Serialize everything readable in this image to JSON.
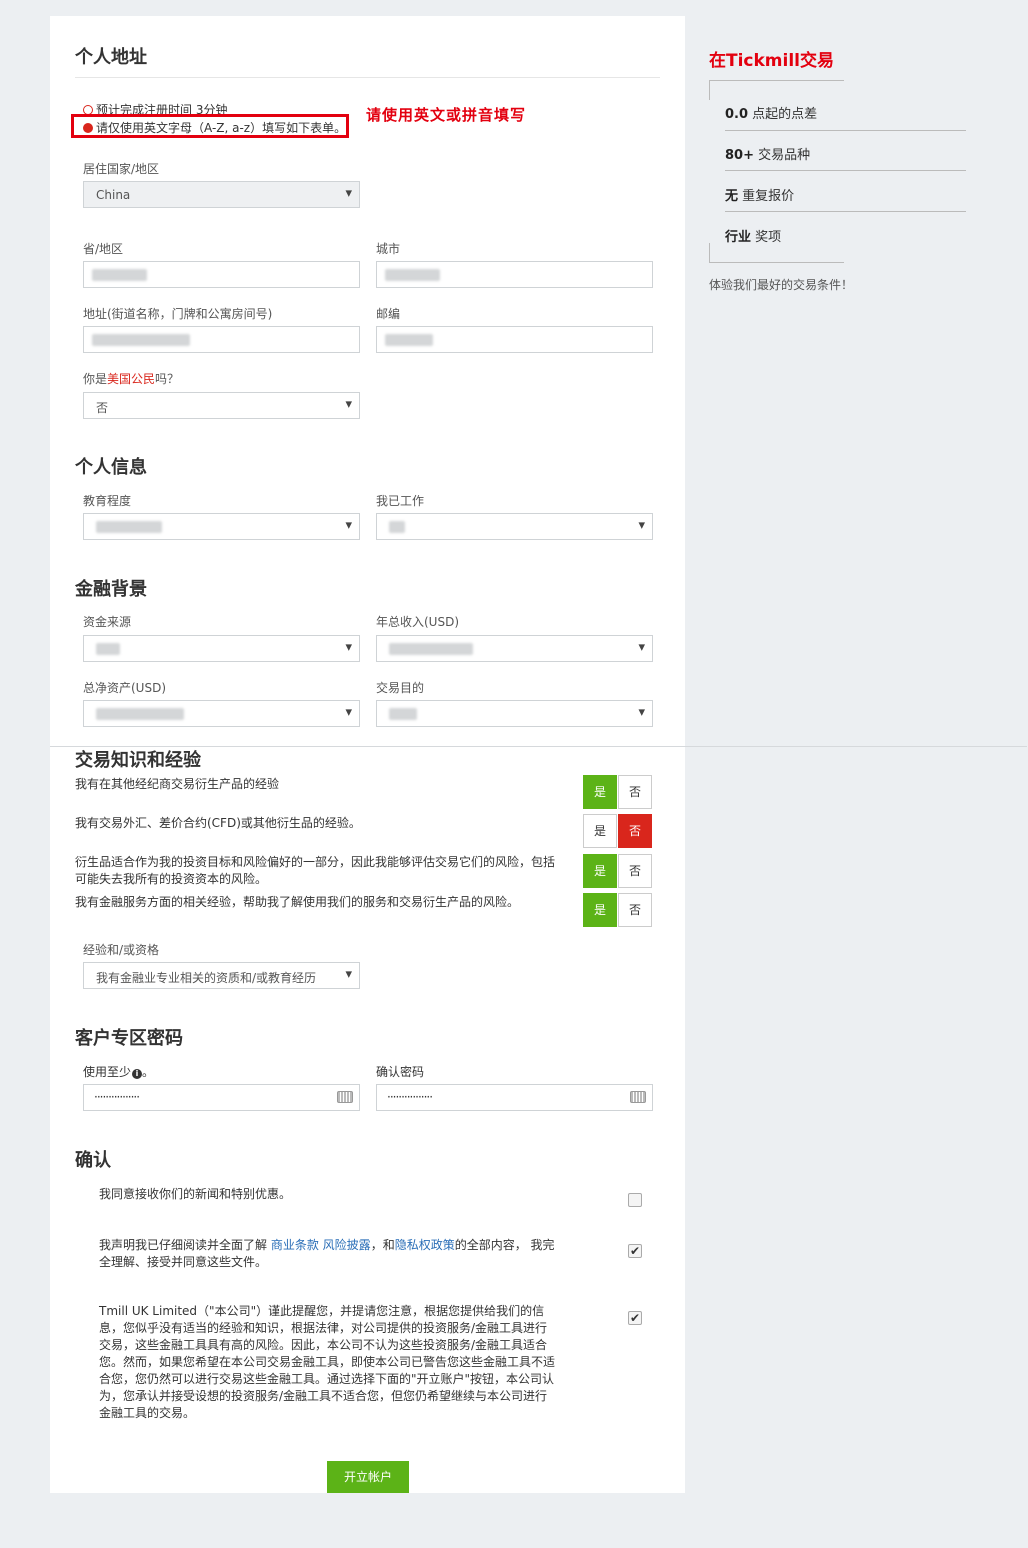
{
  "address_section": {
    "title": "个人地址",
    "hint_time": "预计完成注册时间 3分钟",
    "hint_english": "请仅使用英文字母（A-Z, a-z）填写如下表单。",
    "annotation": "请使用英文或拼音填写",
    "country_label": "居住国家/地区",
    "country_value": "China",
    "province_label": "省/地区",
    "city_label": "城市",
    "address_label": "地址(街道名称，门牌和公寓房间号)",
    "zip_label": "邮编",
    "us_citizen_prefix": "你是",
    "us_citizen_highlight": "美国公民",
    "us_citizen_suffix": "吗？",
    "us_citizen_value": "否"
  },
  "personal_section": {
    "title": "个人信息",
    "education_label": "教育程度",
    "employment_label": "我已工作"
  },
  "financial_section": {
    "title": "金融背景",
    "source_label": "资金来源",
    "income_label": "年总收入(USD)",
    "networth_label": "总净资产(USD)",
    "purpose_label": "交易目的"
  },
  "knowledge_section": {
    "title": "交易知识和经验",
    "yes_label": "是",
    "no_label": "否",
    "questions": [
      {
        "text": "我有在其他经纪商交易衍生产品的经验",
        "answer": "yes"
      },
      {
        "text": "我有交易外汇、差价合约(CFD)或其他衍生品的经验。",
        "answer": "no"
      },
      {
        "text": "衍生品适合作为我的投资目标和风险偏好的一部分，因此我能够评估交易它们的风险，包括可能失去我所有的投资资本的风险。",
        "answer": "yes"
      },
      {
        "text": "我有金融服务方面的相关经验，帮助我了解使用我们的服务和交易衍生产品的风险。",
        "answer": "yes"
      }
    ],
    "qualification_label": "经验和/或资格",
    "qualification_value": "我有金融业专业相关的资质和/或教育经历"
  },
  "password_section": {
    "title": "客户专区密码",
    "password_label": "使用至少",
    "password_label_suffix": "。",
    "confirm_label": "确认密码",
    "password_mask": "················",
    "confirm_mask": "················"
  },
  "confirm_section": {
    "title": "确认",
    "item1": "我同意接收你们的新闻和特别优惠。",
    "item2_prefix": "我声明我已仔细阅读并全面了解 ",
    "item2_link1": "商业条款",
    "item2_link2": "风险披露",
    "item2_mid": "，和",
    "item2_link3": "隐私权政策",
    "item2_suffix": "的全部内容， 我完全理解、接受并同意这些文件。",
    "item3": "Tmill UK Limited（\"本公司\"）谨此提醒您，并提请您注意，根据您提供给我们的信息，您似乎没有适当的经验和知识，根据法律，对公司提供的投资服务/金融工具进行交易，这些金融工具具有高的风险。因此，本公司不认为这些投资服务/金融工具适合您。然而，如果您希望在本公司交易金融工具，即使本公司已警告您这些金融工具不适合您，您仍然可以进行交易这些金融工具。通过选择下面的\"开立账户\"按钮，本公司认为，您承认并接受设想的投资服务/金融工具不适合您，但您仍希望继续与本公司进行金融工具的交易。",
    "checked": [
      false,
      true,
      true
    ],
    "submit_label": "开立帐户"
  },
  "sidebar": {
    "title": "在Tickmill交易",
    "items": [
      {
        "bold": "0.0",
        "rest": " 点起的点差"
      },
      {
        "bold": "80+",
        "rest": " 交易品种"
      },
      {
        "bold": "无",
        "rest": " 重复报价"
      },
      {
        "bold": "行业",
        "rest": " 奖项"
      }
    ],
    "footer": "体验我们最好的交易条件！"
  },
  "colors": {
    "accent_green": "#5cb317",
    "accent_red": "#d9261c",
    "annotation_red": "#e3000f",
    "link_blue": "#2a6eb7"
  }
}
